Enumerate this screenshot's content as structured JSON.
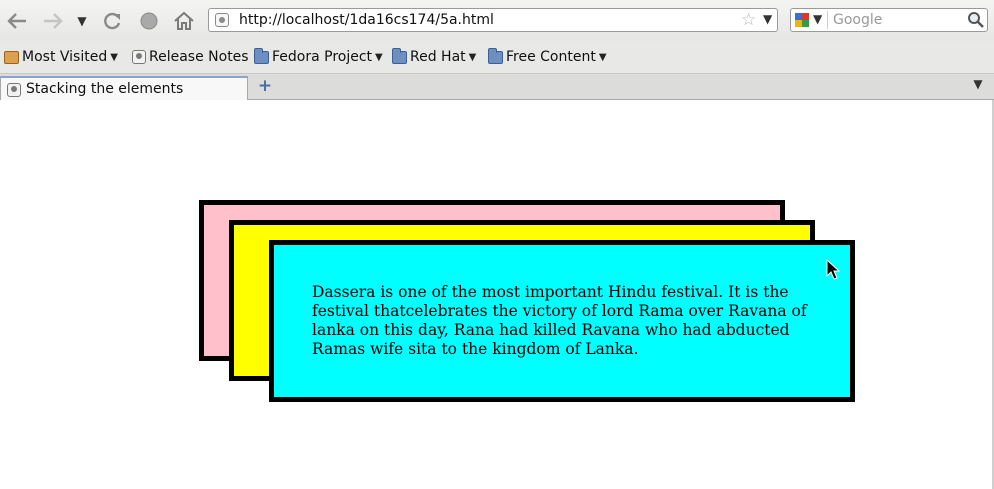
{
  "browser": {
    "url": "http://localhost/1da16cs174/5a.html",
    "search_placeholder": "Google"
  },
  "bookmarks": [
    {
      "label": "Most Visited",
      "icon": "most-visited-icon",
      "dropdown": true
    },
    {
      "label": "Release Notes",
      "icon": "page-icon",
      "dropdown": false
    },
    {
      "label": "Fedora Project",
      "icon": "folder-icon",
      "dropdown": true
    },
    {
      "label": "Red Hat",
      "icon": "folder-icon",
      "dropdown": true
    },
    {
      "label": "Free Content",
      "icon": "folder-icon",
      "dropdown": true
    }
  ],
  "tabs": [
    {
      "title": "Stacking the elements",
      "active": true
    }
  ],
  "page": {
    "paragraph": "Dassera is one of the most important Hindu festival. It is the festival thatcelebrates the victory of lord Rama over Ravana of lanka on this day, Rana had killed Ravana who had abducted Ramas wife sita to the kingdom of Lanka.",
    "box_colors": {
      "back": "#ffc0cb",
      "middle": "#ffff00",
      "front": "#00ffff",
      "border": "#000000"
    }
  }
}
